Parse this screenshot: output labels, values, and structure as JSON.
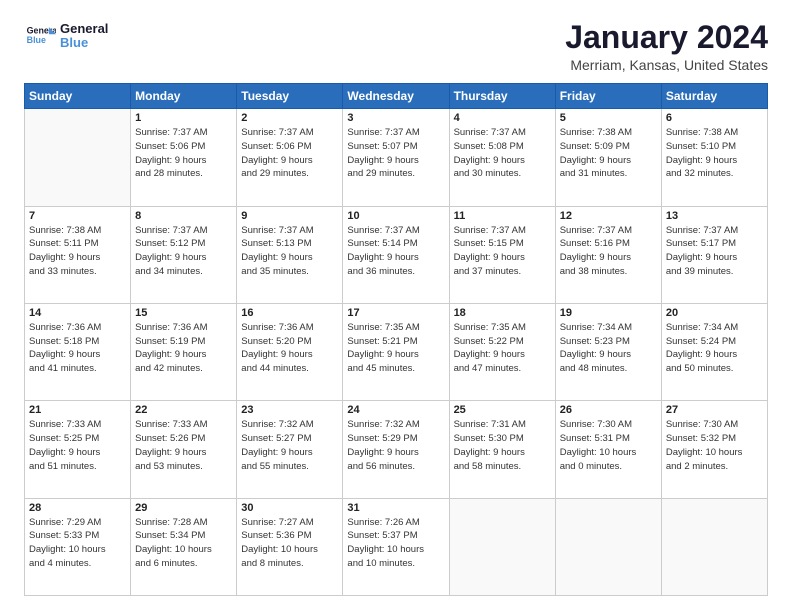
{
  "header": {
    "logo_line1": "General",
    "logo_line2": "Blue",
    "month_title": "January 2024",
    "location": "Merriam, Kansas, United States"
  },
  "days_of_week": [
    "Sunday",
    "Monday",
    "Tuesday",
    "Wednesday",
    "Thursday",
    "Friday",
    "Saturday"
  ],
  "weeks": [
    [
      {
        "day": "",
        "sunrise": "",
        "sunset": "",
        "daylight": ""
      },
      {
        "day": "1",
        "sunrise": "Sunrise: 7:37 AM",
        "sunset": "Sunset: 5:06 PM",
        "daylight": "Daylight: 9 hours and 28 minutes."
      },
      {
        "day": "2",
        "sunrise": "Sunrise: 7:37 AM",
        "sunset": "Sunset: 5:06 PM",
        "daylight": "Daylight: 9 hours and 29 minutes."
      },
      {
        "day": "3",
        "sunrise": "Sunrise: 7:37 AM",
        "sunset": "Sunset: 5:07 PM",
        "daylight": "Daylight: 9 hours and 29 minutes."
      },
      {
        "day": "4",
        "sunrise": "Sunrise: 7:37 AM",
        "sunset": "Sunset: 5:08 PM",
        "daylight": "Daylight: 9 hours and 30 minutes."
      },
      {
        "day": "5",
        "sunrise": "Sunrise: 7:38 AM",
        "sunset": "Sunset: 5:09 PM",
        "daylight": "Daylight: 9 hours and 31 minutes."
      },
      {
        "day": "6",
        "sunrise": "Sunrise: 7:38 AM",
        "sunset": "Sunset: 5:10 PM",
        "daylight": "Daylight: 9 hours and 32 minutes."
      }
    ],
    [
      {
        "day": "7",
        "sunrise": "Sunrise: 7:38 AM",
        "sunset": "Sunset: 5:11 PM",
        "daylight": "Daylight: 9 hours and 33 minutes."
      },
      {
        "day": "8",
        "sunrise": "Sunrise: 7:37 AM",
        "sunset": "Sunset: 5:12 PM",
        "daylight": "Daylight: 9 hours and 34 minutes."
      },
      {
        "day": "9",
        "sunrise": "Sunrise: 7:37 AM",
        "sunset": "Sunset: 5:13 PM",
        "daylight": "Daylight: 9 hours and 35 minutes."
      },
      {
        "day": "10",
        "sunrise": "Sunrise: 7:37 AM",
        "sunset": "Sunset: 5:14 PM",
        "daylight": "Daylight: 9 hours and 36 minutes."
      },
      {
        "day": "11",
        "sunrise": "Sunrise: 7:37 AM",
        "sunset": "Sunset: 5:15 PM",
        "daylight": "Daylight: 9 hours and 37 minutes."
      },
      {
        "day": "12",
        "sunrise": "Sunrise: 7:37 AM",
        "sunset": "Sunset: 5:16 PM",
        "daylight": "Daylight: 9 hours and 38 minutes."
      },
      {
        "day": "13",
        "sunrise": "Sunrise: 7:37 AM",
        "sunset": "Sunset: 5:17 PM",
        "daylight": "Daylight: 9 hours and 39 minutes."
      }
    ],
    [
      {
        "day": "14",
        "sunrise": "Sunrise: 7:36 AM",
        "sunset": "Sunset: 5:18 PM",
        "daylight": "Daylight: 9 hours and 41 minutes."
      },
      {
        "day": "15",
        "sunrise": "Sunrise: 7:36 AM",
        "sunset": "Sunset: 5:19 PM",
        "daylight": "Daylight: 9 hours and 42 minutes."
      },
      {
        "day": "16",
        "sunrise": "Sunrise: 7:36 AM",
        "sunset": "Sunset: 5:20 PM",
        "daylight": "Daylight: 9 hours and 44 minutes."
      },
      {
        "day": "17",
        "sunrise": "Sunrise: 7:35 AM",
        "sunset": "Sunset: 5:21 PM",
        "daylight": "Daylight: 9 hours and 45 minutes."
      },
      {
        "day": "18",
        "sunrise": "Sunrise: 7:35 AM",
        "sunset": "Sunset: 5:22 PM",
        "daylight": "Daylight: 9 hours and 47 minutes."
      },
      {
        "day": "19",
        "sunrise": "Sunrise: 7:34 AM",
        "sunset": "Sunset: 5:23 PM",
        "daylight": "Daylight: 9 hours and 48 minutes."
      },
      {
        "day": "20",
        "sunrise": "Sunrise: 7:34 AM",
        "sunset": "Sunset: 5:24 PM",
        "daylight": "Daylight: 9 hours and 50 minutes."
      }
    ],
    [
      {
        "day": "21",
        "sunrise": "Sunrise: 7:33 AM",
        "sunset": "Sunset: 5:25 PM",
        "daylight": "Daylight: 9 hours and 51 minutes."
      },
      {
        "day": "22",
        "sunrise": "Sunrise: 7:33 AM",
        "sunset": "Sunset: 5:26 PM",
        "daylight": "Daylight: 9 hours and 53 minutes."
      },
      {
        "day": "23",
        "sunrise": "Sunrise: 7:32 AM",
        "sunset": "Sunset: 5:27 PM",
        "daylight": "Daylight: 9 hours and 55 minutes."
      },
      {
        "day": "24",
        "sunrise": "Sunrise: 7:32 AM",
        "sunset": "Sunset: 5:29 PM",
        "daylight": "Daylight: 9 hours and 56 minutes."
      },
      {
        "day": "25",
        "sunrise": "Sunrise: 7:31 AM",
        "sunset": "Sunset: 5:30 PM",
        "daylight": "Daylight: 9 hours and 58 minutes."
      },
      {
        "day": "26",
        "sunrise": "Sunrise: 7:30 AM",
        "sunset": "Sunset: 5:31 PM",
        "daylight": "Daylight: 10 hours and 0 minutes."
      },
      {
        "day": "27",
        "sunrise": "Sunrise: 7:30 AM",
        "sunset": "Sunset: 5:32 PM",
        "daylight": "Daylight: 10 hours and 2 minutes."
      }
    ],
    [
      {
        "day": "28",
        "sunrise": "Sunrise: 7:29 AM",
        "sunset": "Sunset: 5:33 PM",
        "daylight": "Daylight: 10 hours and 4 minutes."
      },
      {
        "day": "29",
        "sunrise": "Sunrise: 7:28 AM",
        "sunset": "Sunset: 5:34 PM",
        "daylight": "Daylight: 10 hours and 6 minutes."
      },
      {
        "day": "30",
        "sunrise": "Sunrise: 7:27 AM",
        "sunset": "Sunset: 5:36 PM",
        "daylight": "Daylight: 10 hours and 8 minutes."
      },
      {
        "day": "31",
        "sunrise": "Sunrise: 7:26 AM",
        "sunset": "Sunset: 5:37 PM",
        "daylight": "Daylight: 10 hours and 10 minutes."
      },
      {
        "day": "",
        "sunrise": "",
        "sunset": "",
        "daylight": ""
      },
      {
        "day": "",
        "sunrise": "",
        "sunset": "",
        "daylight": ""
      },
      {
        "day": "",
        "sunrise": "",
        "sunset": "",
        "daylight": ""
      }
    ]
  ]
}
